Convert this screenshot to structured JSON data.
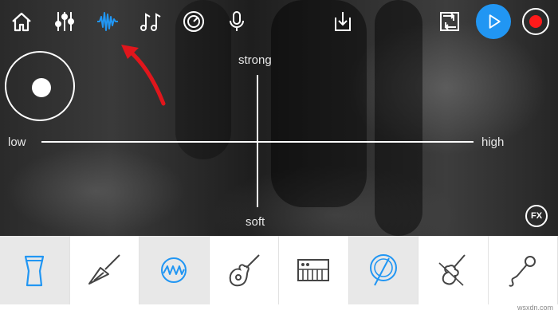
{
  "toolbar": {
    "icons": [
      "home-icon",
      "mixer-icon",
      "waveform-icon",
      "music-notes-icon",
      "knob-icon",
      "microphone-icon",
      "download-icon",
      "loop-icon",
      "play-icon",
      "record-icon"
    ]
  },
  "pad": {
    "label_top": "strong",
    "label_bottom": "soft",
    "label_left": "low",
    "label_right": "high",
    "fx": "FX"
  },
  "instruments": [
    "drum-icon",
    "electric-guitar-icon",
    "synth-wave-icon",
    "acoustic-guitar-icon",
    "keyboard-icon",
    "cymbal-icon",
    "violin-icon",
    "microphone-icon"
  ],
  "colors": {
    "accent": "#2196f3",
    "record": "#ff1a1a",
    "arrow": "#e0161c"
  },
  "footer": {
    "watermark": "wsxdn.com"
  }
}
